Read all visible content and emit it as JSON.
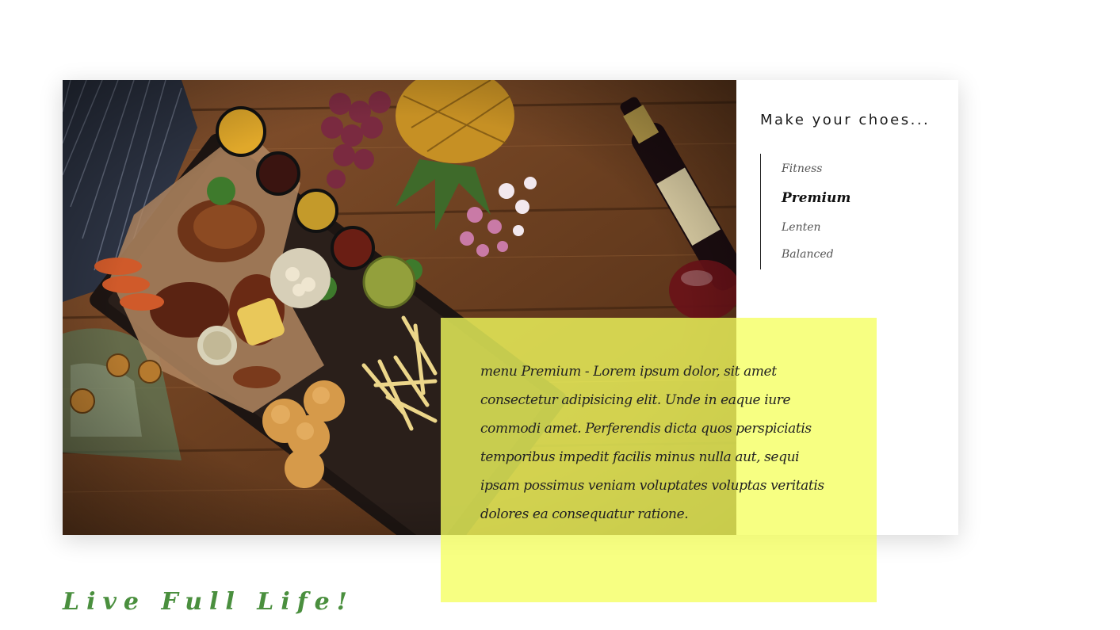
{
  "colors": {
    "accent_yellow": "#f5ff5f",
    "tagline_green": "#4a8f3e",
    "wood": "#6b4124"
  },
  "hero": {
    "image_icon": "food-spread-photo"
  },
  "sidebar": {
    "title": "Make your choes...",
    "items": [
      {
        "label": "Fitness",
        "active": false
      },
      {
        "label": "Premium",
        "active": true
      },
      {
        "label": "Lenten",
        "active": false
      },
      {
        "label": "Balanced",
        "active": false
      }
    ]
  },
  "description": {
    "text": "menu Premium - Lorem ipsum dolor, sit amet consectetur adipisicing elit. Unde in eaque iure commodi amet. Perferendis dicta quos perspiciatis temporibus impedit facilis minus nulla aut, sequi ipsam possimus veniam voluptates voluptas veritatis dolores ea consequatur ratione."
  },
  "footer": {
    "tagline": "Live Full Life!"
  }
}
